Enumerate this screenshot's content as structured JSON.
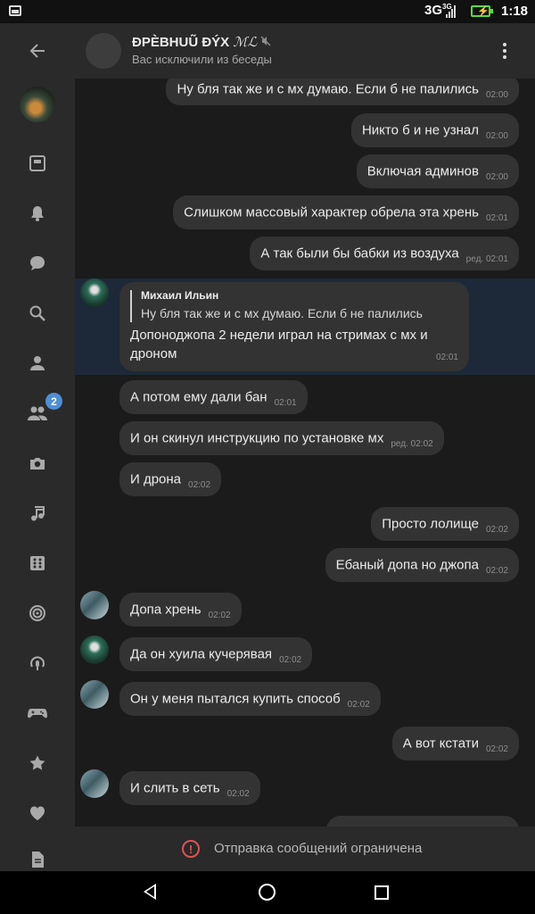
{
  "status_bar": {
    "network": "3G",
    "network_sup": "3G",
    "time": "1:18"
  },
  "header": {
    "title": "ĐPÈBHUŨ ĐÝX",
    "title_suffix": "ℳℒ",
    "subtitle": "Вас исключили из беседы"
  },
  "rail": {
    "icons": [
      "back-arrow-icon",
      "user-avatar",
      "news-icon",
      "bell-icon",
      "chat-icon",
      "search-icon",
      "person-icon",
      "friends-icon",
      "camera-icon",
      "music-icon",
      "apps-icon",
      "target-icon",
      "podcast-icon",
      "gamepad-icon",
      "star-icon",
      "heart-icon",
      "document-icon"
    ],
    "friends_badge": "2"
  },
  "messages": {
    "m1": {
      "text": "Ну бля так же и с мх думаю. Если б не палились",
      "time": "02:00"
    },
    "m2": {
      "text": "Никто б и не узнал",
      "time": "02:00"
    },
    "m3": {
      "text": "Включая админов",
      "time": "02:00"
    },
    "m4": {
      "text": "Слишком массовый характер обрела эта хрень",
      "time": "02:01"
    },
    "m5": {
      "text": "А так были бы бабки из воздуха",
      "time": "ред. 02:01"
    },
    "reply": {
      "author": "Михаил Ильин",
      "quote": "Ну бля так же и с мх думаю. Если б не палились",
      "text": "Допоноджопа 2 недели играл на стримах с мх и дроном",
      "time": "02:01"
    },
    "m6": {
      "text": "А потом ему дали бан",
      "time": "02:01"
    },
    "m7": {
      "text": "И он скинул инструкцию по установке мх",
      "time": "ред. 02:02"
    },
    "m8": {
      "text": "И дрона",
      "time": "02:02"
    },
    "m9": {
      "text": "Просто лолище",
      "time": "02:02"
    },
    "m10": {
      "text": "Ебаный допа но джопа",
      "time": "02:02"
    },
    "m11": {
      "text": "Допа хрень",
      "time": "02:02"
    },
    "m12": {
      "text": "Да он хуила кучерявая",
      "time": "02:02"
    },
    "m13": {
      "text": "Он у меня пытался купить способ",
      "time": "02:02"
    },
    "m14": {
      "text": "А вот кстати",
      "time": "02:02"
    },
    "m15": {
      "text": "И слить в сеть",
      "time": "02:02"
    }
  },
  "footer": {
    "text": "Отправка сообщений ограничена"
  }
}
